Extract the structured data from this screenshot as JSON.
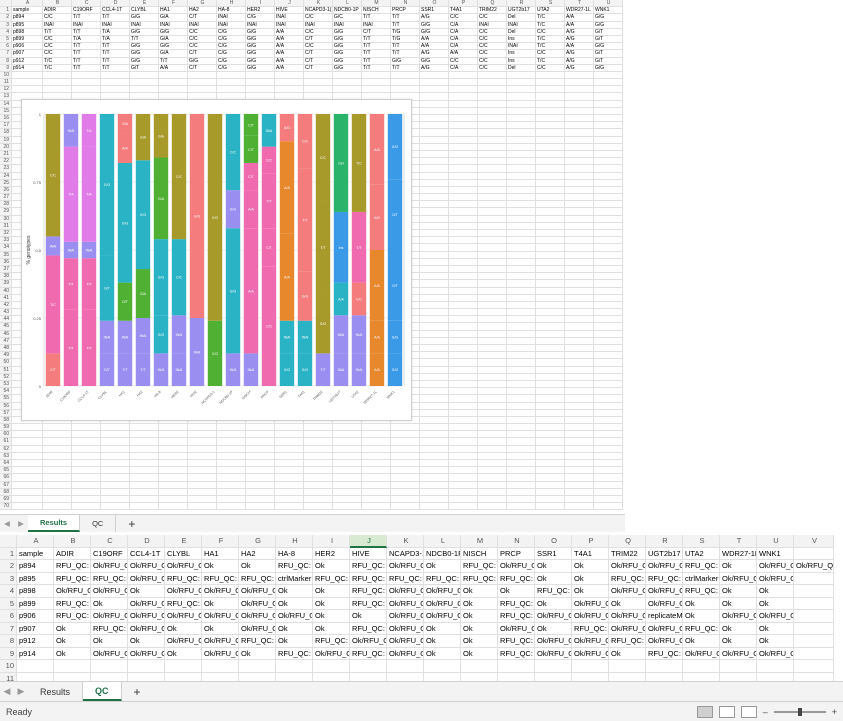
{
  "results": {
    "columns": [
      "",
      "A",
      "B",
      "C",
      "D",
      "E",
      "F",
      "G",
      "H",
      "I",
      "J",
      "K",
      "L",
      "M",
      "N",
      "O",
      "P",
      "Q",
      "R",
      "S",
      "T",
      "U"
    ],
    "rows": [
      [
        "sample",
        "ADIR",
        "C19ORF",
        "CCL4-1T",
        "CLYBL",
        "HA1",
        "HA2",
        "HA-8",
        "HER2",
        "HIVE",
        "NCAPD3-1(",
        "NDCB0-1P",
        "NISCH",
        "PRCP",
        "SSR1",
        "T4A1",
        "TRIM22",
        "UGT2b17",
        "UTA2",
        "WDR27-1L",
        "WNK1"
      ],
      [
        "p894",
        "C/C",
        "T/T",
        "T/T",
        "G/G",
        "G/A",
        "C/T",
        "INAI",
        "C/G",
        "INAI",
        "C/C",
        "G/C",
        "T/T",
        "T/T",
        "A/G",
        "C/C",
        "C/C",
        "Del",
        "T/C",
        "A/A",
        "G/G"
      ],
      [
        "p895",
        "INAI",
        "INAI",
        "INAI",
        "INAI",
        "INAI",
        "INAI",
        "INAI",
        "INAI",
        "INAI",
        "INAI",
        "INAI",
        "INAI",
        "T/T",
        "G/G",
        "C/A",
        "INAI",
        "INAI",
        "T/C",
        "A/A",
        "G/G"
      ],
      [
        "p898",
        "T/T",
        "T/T",
        "T/A",
        "G/G",
        "G/G",
        "C/C",
        "C/G",
        "G/G",
        "A/A",
        "C/C",
        "G/G",
        "C/T",
        "T/G",
        "G/G",
        "C/A",
        "C/C",
        "Del",
        "C/C",
        "A/G",
        "G/T"
      ],
      [
        "p899",
        "C/C",
        "T/A",
        "T/A",
        "T/T",
        "G/A",
        "C/C",
        "C/G",
        "G/G",
        "A/A",
        "C/T",
        "G/G",
        "T/T",
        "T/G",
        "A/A",
        "C/A",
        "C/C",
        "Ins",
        "T/C",
        "A/G",
        "G/T"
      ],
      [
        "p906",
        "C/C",
        "T/T",
        "T/T",
        "G/G",
        "G/G",
        "C/C",
        "C/G",
        "G/G",
        "A/A",
        "C/C",
        "G/G",
        "T/T",
        "T/T",
        "A/A",
        "C/A",
        "C/C",
        "INAI",
        "T/C",
        "A/A",
        "G/G"
      ],
      [
        "p907",
        "C/C",
        "T/T",
        "T/T",
        "G/G",
        "G/A",
        "C/T",
        "C/G",
        "G/G",
        "A/A",
        "C/T",
        "G/G",
        "T/T",
        "T/T",
        "A/G",
        "A/A",
        "C/C",
        "Ins",
        "C/C",
        "A/G",
        "G/T"
      ],
      [
        "p912",
        "T/C",
        "T/T",
        "T/T",
        "G/G",
        "T/T",
        "G/G",
        "C/G",
        "G/G",
        "A/A",
        "C/T",
        "G/G",
        "T/T",
        "G/G",
        "G/G",
        "C/C",
        "C/C",
        "Ins",
        "T/C",
        "A/G",
        "G/T"
      ],
      [
        "p914",
        "T/C",
        "T/T",
        "T/T",
        "G/T",
        "A/A",
        "C/T",
        "C/G",
        "G/G",
        "A/A",
        "C/T",
        "G/G",
        "T/T",
        "T/T",
        "A/G",
        "C/A",
        "C/C",
        "Del",
        "C/C",
        "A/G",
        "G/G"
      ]
    ],
    "blank_row_numbers": [
      "10",
      "11",
      "12",
      "13",
      "14",
      "15",
      "16",
      "17",
      "18",
      "19",
      "20",
      "21",
      "22",
      "23",
      "24",
      "25",
      "26",
      "27",
      "28",
      "29",
      "30",
      "31",
      "32",
      "33",
      "34",
      "35",
      "36",
      "37",
      "38",
      "39",
      "40",
      "41",
      "42",
      "43",
      "44",
      "45",
      "46",
      "47",
      "48",
      "49",
      "50",
      "51",
      "52",
      "53",
      "54",
      "55",
      "56",
      "57",
      "58",
      "59",
      "60",
      "61",
      "62",
      "63",
      "64",
      "65",
      "66",
      "67",
      "68",
      "69",
      "70"
    ],
    "tabs": [
      {
        "label": "Results",
        "active": true
      },
      {
        "label": "QC",
        "active": false
      }
    ],
    "add_tab": "+"
  },
  "qc": {
    "columns": [
      "",
      "A",
      "B",
      "C",
      "D",
      "E",
      "F",
      "G",
      "H",
      "I",
      "J",
      "K",
      "L",
      "M",
      "N",
      "O",
      "P",
      "Q",
      "R",
      "S",
      "T",
      "U",
      "V"
    ],
    "selected_column": "J",
    "rows": [
      [
        "sample",
        "ADIR",
        "C19ORF",
        "CCL4-1T",
        "CLYBL",
        "HA1",
        "HA2",
        "HA-8",
        "HER2",
        "HIVE",
        "NCAPD3-1(",
        "NDCB0-1P",
        "NISCH",
        "PRCP",
        "SSR1",
        "T4A1",
        "TRIM22",
        "UGT2b17",
        "UTA2",
        "WDR27-1L",
        "WNK1",
        ""
      ],
      [
        "p894",
        "RFU_QC: Low;",
        "Ok/RFU_QC",
        "Ok/RFU_QC",
        "Ok/RFU_QC",
        "Ok",
        "Ok",
        "RFU_QC: Lc",
        "Ok",
        "RFU_QC: Lc",
        "Ok/RFU_QC",
        "Ok",
        "RFU_QC: Lc",
        "Ok/RFU_QC",
        "Ok",
        "Ok",
        "Ok/RFU_QC",
        "Ok/RFU_QC",
        "RFU_QC: Lc",
        "Ok",
        "Ok/RFU_QC",
        "Ok/RFU_QC: Low; an"
      ],
      [
        "p895",
        "RFU_QC: Low;",
        "RFU_QC: Lc",
        "Ok/RFU_QC",
        "RFU_QC: Lc",
        "RFU_QC: Lc",
        "RFU_QC: Lc",
        "ctrlMarker",
        "RFU_QC: Lc",
        "RFU_QC: Lc",
        "RFU_QC: Lc",
        "RFU_QC: Lc",
        "RFU_QC: Lc",
        "RFU_QC: Lc",
        "Ok",
        "Ok",
        "RFU_QC: Lc",
        "RFU_QC: Lc",
        "ctrlMarker",
        "Ok/RFU_QC",
        "Ok/RFU_QC: Low; an",
        ""
      ],
      [
        "p898",
        "Ok/RFU_QC: Lc",
        "Ok/RFU_QC",
        "Ok",
        "Ok/RFU_QC",
        "Ok/RFU_QC",
        "Ok/RFU_QC",
        "Ok",
        "Ok",
        "RFU_QC: Lc",
        "Ok/RFU_QC",
        "Ok/RFU_QC",
        "Ok",
        "Ok",
        "RFU_QC: Lc",
        "Ok",
        "Ok/RFU_QC",
        "Ok/RFU_QC",
        "RFU_QC: Lc",
        "Ok",
        "Ok",
        ""
      ],
      [
        "p899",
        "RFU_QC: Low;",
        "Ok",
        "Ok/RFU_QC",
        "RFU_QC: Lc",
        "Ok",
        "Ok/RFU_QC",
        "Ok",
        "Ok",
        "RFU_QC: Lc",
        "Ok/RFU_QC",
        "Ok/RFU_QC",
        "Ok",
        "RFU_QC: Lc",
        "Ok",
        "Ok/RFU_QC",
        "Ok",
        "Ok/RFU_QC",
        "Ok",
        "Ok",
        "Ok",
        ""
      ],
      [
        "p906",
        "RFU_QC: Low;",
        "Ok/RFU_QC",
        "Ok/RFU_QC",
        "Ok/RFU_QC",
        "Ok/RFU_QC",
        "Ok/RFU_QC",
        "Ok/RFU_QC",
        "Ok",
        "Ok",
        "Ok/RFU_QC",
        "Ok/RFU_QC",
        "Ok",
        "RFU_QC: Lc",
        "Ok/RFU_QC",
        "Ok/RFU_QC",
        "Ok/RFU_QC",
        "replicateM",
        "Ok",
        "Ok/RFU_QC",
        "Ok/RFU_QC: Low; an",
        ""
      ],
      [
        "p907",
        "Ok",
        "RFU_QC: Lc",
        "Ok/RFU_QC",
        "Ok",
        "Ok",
        "Ok/RFU_QC",
        "Ok",
        "Ok",
        "RFU_QC: Lc",
        "Ok/RFU_QC",
        "Ok",
        "Ok",
        "Ok/RFU_QC",
        "Ok",
        "RFU_QC: Lc",
        "Ok/RFU_QC",
        "Ok/RFU_QC",
        "RFU_QC: Lc",
        "Ok",
        "Ok",
        ""
      ],
      [
        "p912",
        "Ok",
        "Ok",
        "Ok",
        "Ok/RFU_QC",
        "Ok/RFU_QC",
        "RFU_QC: Lc",
        "Ok",
        "RFU_QC: Lc",
        "Ok/RFU_QC",
        "Ok/RFU_QC",
        "Ok",
        "Ok",
        "RFU_QC: Lc",
        "Ok/RFU_QC",
        "Ok/RFU_QC",
        "RFU_QC: Lc",
        "Ok/RFU_QC",
        "Ok",
        "Ok",
        "Ok",
        ""
      ],
      [
        "p914",
        "Ok",
        "Ok/RFU_QC",
        "Ok/RFU_QC",
        "Ok",
        "Ok/RFU_QC",
        "Ok",
        "RFU_QC: Lc",
        "Ok/RFU_QC",
        "RFU_QC: Lc",
        "Ok/RFU_QC",
        "Ok",
        "Ok",
        "RFU_QC: Lc",
        "Ok/RFU_QC",
        "Ok/RFU_QC",
        "Ok",
        "RFU_QC: Lc",
        "Ok/RFU_QC",
        "Ok/RFU_QC",
        "Ok/RFU_QC: Low; an",
        ""
      ]
    ],
    "blank_row_numbers": [
      "10",
      "11",
      "12"
    ],
    "tabs": [
      {
        "label": "Results",
        "active": false
      },
      {
        "label": "QC",
        "active": true
      }
    ],
    "add_tab": "+"
  },
  "status": {
    "ready": "Ready"
  },
  "chart_data": {
    "type": "bar",
    "stacked": true,
    "categories": [
      "ADIR",
      "C19ORF",
      "CCL4-1T",
      "CLYBL",
      "HA1",
      "HA2",
      "HA-8",
      "HER2",
      "HIVE",
      "NCAPD3-1",
      "NDCB0-1P",
      "NISCH",
      "PRCP",
      "SSR1",
      "T4A1",
      "TRIM22",
      "UGT2b17",
      "UTA2",
      "WDR27-1L",
      "WNK1"
    ],
    "ylim": [
      0,
      1
    ],
    "yticks": [
      "0",
      "0.25",
      "0.5",
      "0.75",
      "1"
    ],
    "ylabel": "% genotypes",
    "bars": [
      [
        [
          0.12,
          "#f47c7c",
          "C/T"
        ],
        [
          0.36,
          "#f06ab0",
          "T/C"
        ],
        [
          0.07,
          "#9a8ff0",
          "INAI"
        ],
        [
          0.45,
          "#a89a2a",
          "C/C"
        ]
      ],
      [
        [
          0.28,
          "#f06ab0",
          "T/T"
        ],
        [
          0.19,
          "#f06ab0",
          "T/T"
        ],
        [
          0.06,
          "#9a8ff0",
          "INAI"
        ],
        [
          0.35,
          "#e07be8",
          "T/A"
        ],
        [
          0.12,
          "#9a8ff0",
          "INAI"
        ]
      ],
      [
        [
          0.28,
          "#f06ab0",
          "T/T"
        ],
        [
          0.19,
          "#f06ab0",
          "T/T"
        ],
        [
          0.06,
          "#9a8ff0",
          "INAI"
        ],
        [
          0.35,
          "#e07be8",
          "T/A"
        ],
        [
          0.12,
          "#e07be8",
          "T/A"
        ]
      ],
      [
        [
          0.12,
          "#9a8ff0",
          "G/T"
        ],
        [
          0.12,
          "#9a8ff0",
          "INAI"
        ],
        [
          0.24,
          "#2ab3c5",
          "G/T"
        ],
        [
          0.52,
          "#2ab3c5",
          "G/G"
        ]
      ],
      [
        [
          0.12,
          "#9a8ff0",
          "T/T"
        ],
        [
          0.12,
          "#9a8ff0",
          "INAI"
        ],
        [
          0.14,
          "#4fb033",
          "G/T"
        ],
        [
          0.44,
          "#2ab3c5",
          "G/G"
        ],
        [
          0.11,
          "#f47c7c",
          "A/A"
        ],
        [
          0.07,
          "#f47c7c",
          "G/A"
        ]
      ],
      [
        [
          0.12,
          "#9a8ff0",
          "T/T"
        ],
        [
          0.13,
          "#9a8ff0",
          "INAI"
        ],
        [
          0.18,
          "#4fb033",
          "G/A"
        ],
        [
          0.4,
          "#2ab3c5",
          "G/G"
        ],
        [
          0.17,
          "#a89a2a",
          "G/A"
        ]
      ],
      [
        [
          0.12,
          "#9a8ff0",
          "INAI"
        ],
        [
          0.14,
          "#2ab3c5",
          "G/G"
        ],
        [
          0.28,
          "#2ab3c5",
          "G/G"
        ],
        [
          0.3,
          "#4fb033",
          "G/A"
        ],
        [
          0.16,
          "#a89a2a",
          "G/A"
        ]
      ],
      [
        [
          0.12,
          "#9a8ff0",
          "INAI"
        ],
        [
          0.14,
          "#9a8ff0",
          "INAI"
        ],
        [
          0.28,
          "#2ab3c5",
          "C/C"
        ],
        [
          0.46,
          "#a89a2a",
          "C/C"
        ]
      ],
      [
        [
          0.25,
          "#9a8ff0",
          "INAI"
        ],
        [
          0.75,
          "#f47c7c",
          "G/G"
        ]
      ],
      [
        [
          0.24,
          "#4fb033",
          "C/G"
        ],
        [
          0.76,
          "#a89a2a",
          "C/G"
        ]
      ],
      [
        [
          0.12,
          "#9a8ff0",
          "INAI"
        ],
        [
          0.46,
          "#2ab3c5",
          "G/G"
        ],
        [
          0.14,
          "#9a8ff0",
          "G/G"
        ],
        [
          0.28,
          "#2ab3c5",
          "C/C"
        ]
      ],
      [
        [
          0.12,
          "#9a8ff0",
          "INAI"
        ],
        [
          0.46,
          "#f06ab0",
          "A/A"
        ],
        [
          0.14,
          "#f06ab0",
          "A/A"
        ],
        [
          0.1,
          "#f06ab0",
          "C/T"
        ],
        [
          0.1,
          "#4fb033",
          "C/T"
        ],
        [
          0.08,
          "#4fb033",
          "C/T"
        ]
      ],
      [
        [
          0.44,
          "#f06ab0",
          "C/C"
        ],
        [
          0.14,
          "#f06ab0",
          "C/T"
        ],
        [
          0.2,
          "#f06ab0",
          "T/T"
        ],
        [
          0.1,
          "#f06ab0",
          "C/C"
        ],
        [
          0.12,
          "#2ab3c5",
          "INAI"
        ]
      ],
      [
        [
          0.12,
          "#2ab3c5",
          "G/G"
        ],
        [
          0.12,
          "#2ab3c5",
          "INAI"
        ],
        [
          0.32,
          "#e8882c",
          "A/A"
        ],
        [
          0.34,
          "#e8882c",
          "A/A"
        ],
        [
          0.1,
          "#f47c7c",
          "A/G"
        ]
      ],
      [
        [
          0.12,
          "#2ab3c5",
          "G/G"
        ],
        [
          0.12,
          "#2ab3c5",
          "INAI"
        ],
        [
          0.18,
          "#f47c7c",
          "G/G"
        ],
        [
          0.38,
          "#f47c7c",
          "T/T"
        ],
        [
          0.2,
          "#f47c7c",
          "C/C"
        ]
      ],
      [
        [
          0.12,
          "#9a8ff0",
          "T/T"
        ],
        [
          0.22,
          "#a89a2a",
          "G/G"
        ],
        [
          0.34,
          "#a89a2a",
          "T/T"
        ],
        [
          0.32,
          "#a89a2a",
          "C/C"
        ]
      ],
      [
        [
          0.12,
          "#9a8ff0",
          "INAI"
        ],
        [
          0.14,
          "#9a8ff0",
          "INAI"
        ],
        [
          0.12,
          "#2ab3c5",
          "A/A"
        ],
        [
          0.26,
          "#3a9ae8",
          "Ins"
        ],
        [
          0.36,
          "#2ab36a",
          "Del"
        ]
      ],
      [
        [
          0.12,
          "#9a8ff0",
          "INAI"
        ],
        [
          0.14,
          "#9a8ff0",
          "INAI"
        ],
        [
          0.12,
          "#f47c7c",
          "C/C"
        ],
        [
          0.26,
          "#f06ab0",
          "T/T"
        ],
        [
          0.36,
          "#a89a2a",
          "T/C"
        ]
      ],
      [
        [
          0.12,
          "#e8882c",
          "A/A"
        ],
        [
          0.12,
          "#e8882c",
          "A/A"
        ],
        [
          0.26,
          "#e8882c",
          "A/A"
        ],
        [
          0.24,
          "#f47c7c",
          "A/G"
        ],
        [
          0.26,
          "#f47c7c",
          "A/A"
        ]
      ],
      [
        [
          0.12,
          "#3a9ae8",
          "G/G"
        ],
        [
          0.12,
          "#3a9ae8",
          "G/G"
        ],
        [
          0.26,
          "#3a9ae8",
          "G/T"
        ],
        [
          0.26,
          "#3a9ae8",
          "G/T"
        ],
        [
          0.24,
          "#3a9ae8",
          "G/G"
        ]
      ]
    ]
  }
}
